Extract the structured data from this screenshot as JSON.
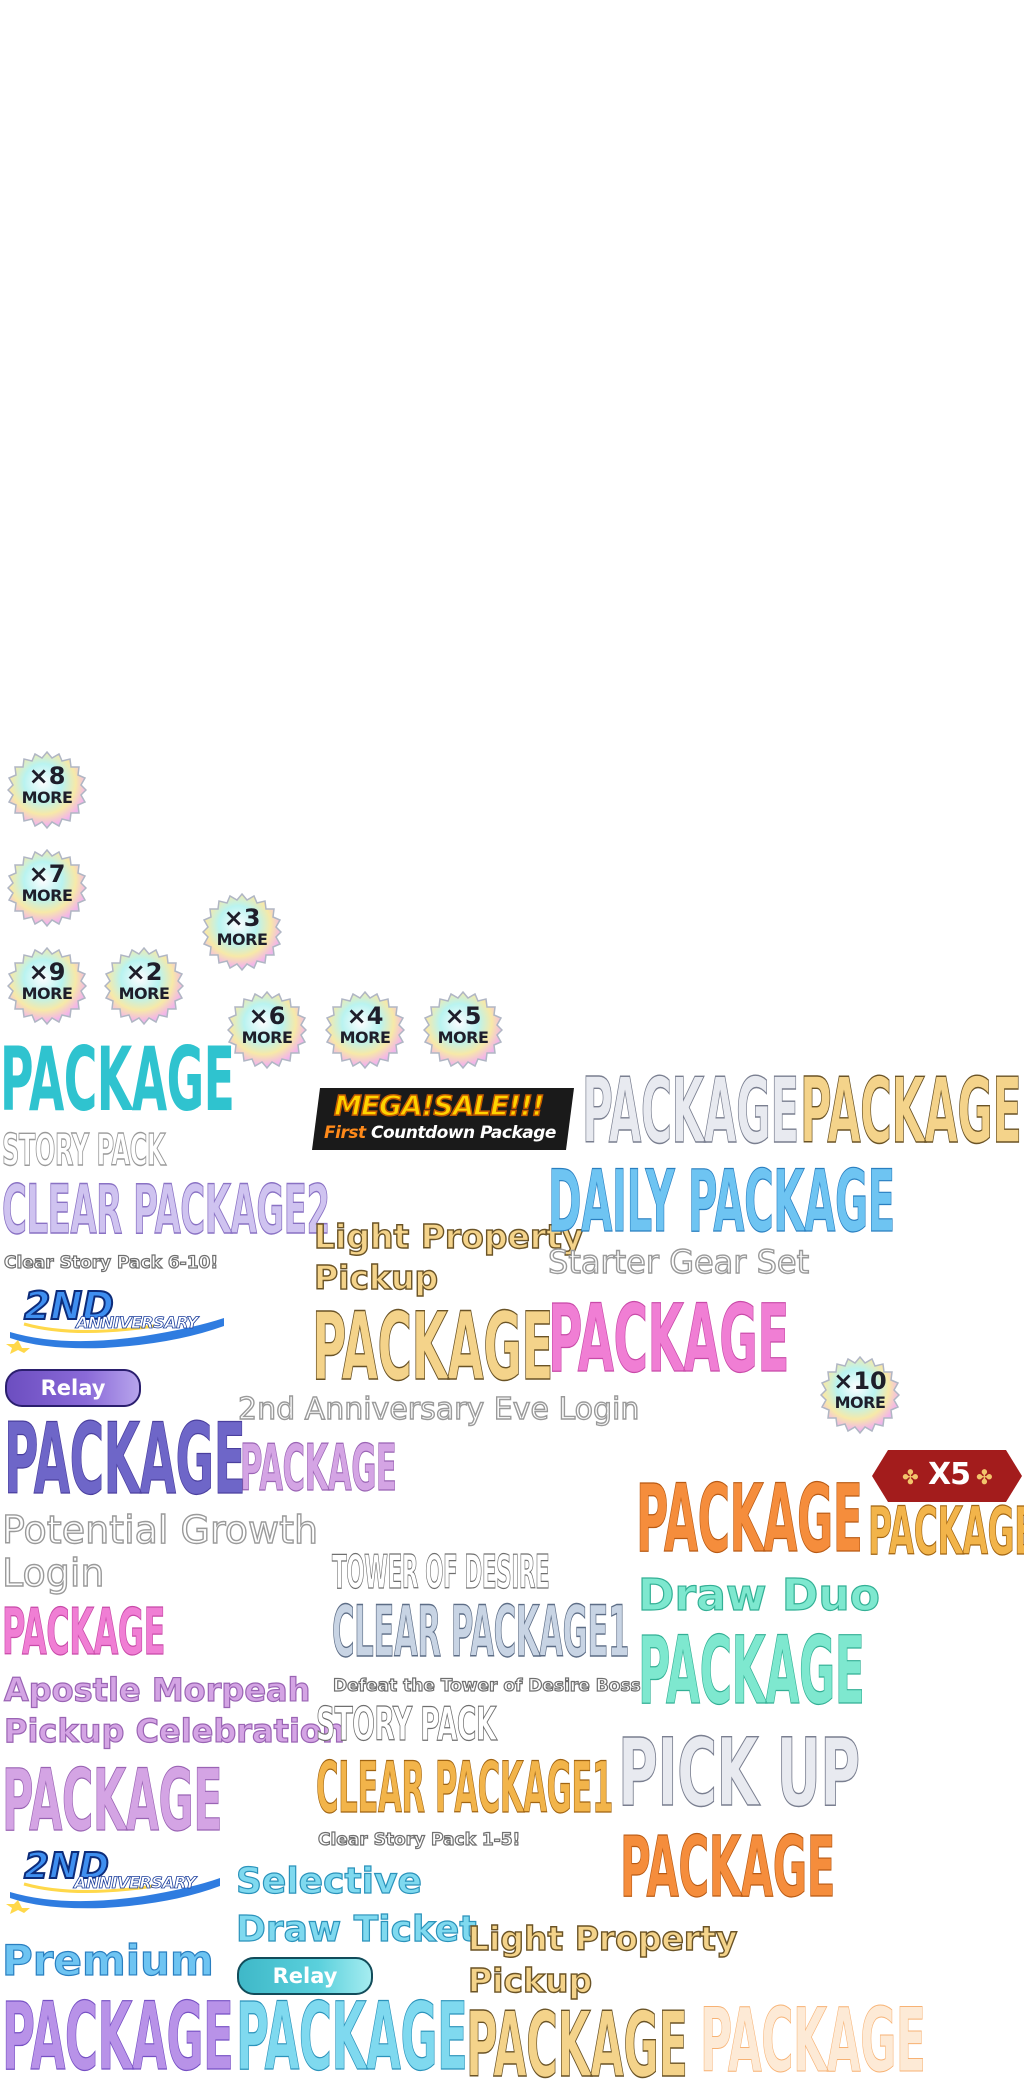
{
  "colors": {
    "teal": "#2fc3cf",
    "violet": "#6e66c8",
    "pink": "#f07ed4",
    "cream": "#f4d38a",
    "orange": "#f58d3c",
    "mint": "#7ee8cf",
    "red": "#a31c1c",
    "badge_outline": "#b0b6c4"
  },
  "badges": [
    {
      "mult": "×8",
      "more": "MORE"
    },
    {
      "mult": "×7",
      "more": "MORE"
    },
    {
      "mult": "×3",
      "more": "MORE"
    },
    {
      "mult": "×9",
      "more": "MORE"
    },
    {
      "mult": "×2",
      "more": "MORE"
    },
    {
      "mult": "×6",
      "more": "MORE"
    },
    {
      "mult": "×4",
      "more": "MORE"
    },
    {
      "mult": "×5",
      "more": "MORE"
    },
    {
      "mult": "×10",
      "more": "MORE"
    }
  ],
  "labels": {
    "package_teal": "PACKAGE",
    "mega_sale": "MEGA!SALE!!!",
    "first_countdown_first": "First",
    "first_countdown_rest": "Countdown Package",
    "package_silver": "PACKAGE",
    "package_cream_top": "PACKAGE",
    "story_pack_a": "STORY PACK",
    "clear_package2": "CLEAR PACKAGE2",
    "clear_story_6_10": "Clear Story Pack 6-10!",
    "daily_package": "DAILY PACKAGE",
    "light_property_a_1": "Light Property",
    "light_property_a_2": "Pickup",
    "package_cream_mid": "PACKAGE",
    "starter_gear_set": "Starter Gear Set",
    "package_pink": "PACKAGE",
    "anniv_2nd_a": "2ND",
    "anniv_word_a": "ANNIVERSARY",
    "relay_a": "Relay",
    "package_violet": "PACKAGE",
    "anniv_eve_login": "2nd Anniversary Eve Login",
    "package_lilac_small": "PACKAGE",
    "x5": "X5",
    "package_orange": "PACKAGE",
    "package_gold_small": "PACKAGE",
    "potential_growth": "Potential Growth",
    "login": "Login",
    "tower_of_desire": "TOWER OF DESIRE",
    "clear_package1_a": "CLEAR PACKAGE1",
    "defeat_tower": "Defeat the Tower of Desire Boss!",
    "draw_duo": "Draw Duo",
    "package_mint": "PACKAGE",
    "package_pink2": "PACKAGE",
    "apostle_1": "Apostle Morpeah",
    "apostle_2": "Pickup Celebration",
    "story_pack_b": "STORY PACK",
    "clear_package1_b": "CLEAR PACKAGE1",
    "pick_up": "PICK UP",
    "package_lilac_big": "PACKAGE",
    "clear_story_1_5": "Clear Story Pack 1-5!",
    "package_orange2": "PACKAGE",
    "anniv_2nd_b": "2ND",
    "anniv_word_b": "ANNIVERSARY",
    "selective": "Selective",
    "draw_ticket": "Draw Ticket",
    "relay_b": "Relay",
    "light_property_b_1": "Light Property",
    "light_property_b_2": "Pickup",
    "premium": "Premium",
    "package_purple": "PACKAGE",
    "package_cyan": "PACKAGE",
    "package_cream_bot": "PACKAGE",
    "package_peach": "PACKAGE"
  }
}
